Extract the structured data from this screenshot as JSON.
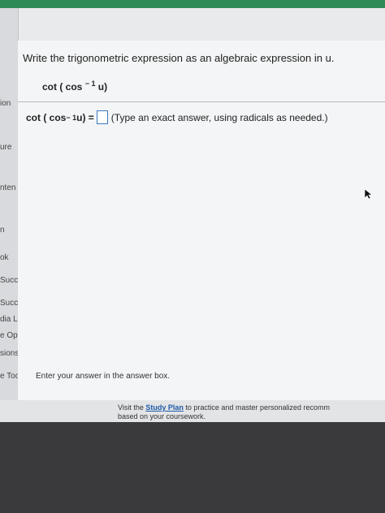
{
  "question": "Write the trigonometric expression as an algebraic expression in u.",
  "expression": {
    "prefix": "cot ( cos",
    "exponent": "− 1",
    "suffix": "u)"
  },
  "answer": {
    "lhs_prefix": "cot ( cos",
    "lhs_exponent": "− 1",
    "lhs_suffix": "u) =",
    "value": "",
    "hint": "(Type an exact answer, using radicals as needed.)"
  },
  "instruction": "Enter your answer in the answer box.",
  "sidebar": {
    "items": [
      "ion",
      "ure",
      "nten",
      "n",
      "ok",
      "Succe",
      "Succe",
      "dia Libr",
      "e Optio",
      "sions",
      "e Tools"
    ]
  },
  "footer": {
    "prefix": "Visit the",
    "link": "Study Plan",
    "suffix": "to practice and master personalized recomm",
    "line2": "based on your coursework."
  },
  "colors": {
    "topbar": "#2f8a57",
    "link": "#1f5ba8",
    "answer_box_border": "#3b78c2"
  }
}
